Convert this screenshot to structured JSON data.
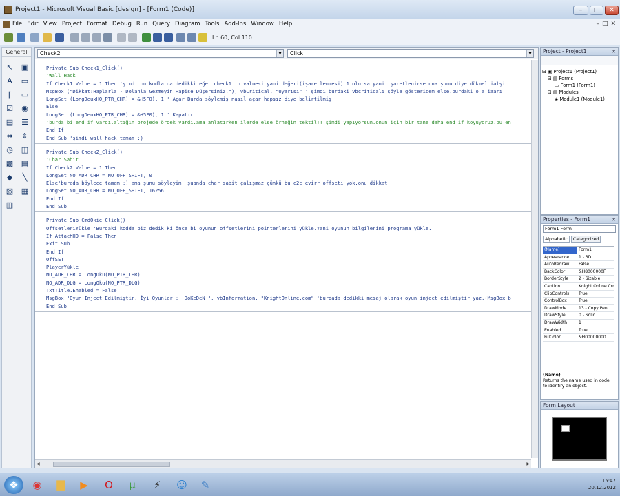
{
  "window": {
    "title": "Project1 - Microsoft Visual Basic [design] - [Form1 (Code)]",
    "controls": [
      "–",
      "□",
      "✕"
    ]
  },
  "menu": {
    "items": [
      "File",
      "Edit",
      "View",
      "Project",
      "Format",
      "Debug",
      "Run",
      "Query",
      "Diagram",
      "Tools",
      "Add-Ins",
      "Window",
      "Help"
    ],
    "mdi_controls": [
      "–",
      "□",
      "✕"
    ]
  },
  "toolbar": {
    "position": "Ln 60, Col 110"
  },
  "toolbox": {
    "header": "General"
  },
  "code_window": {
    "object_combo": "Check2",
    "proc_combo": "Click",
    "procedures": [
      {
        "lines": [
          {
            "t": "Private Sub Check1_Click()",
            "c": "mix"
          },
          {
            "t": "'Wall Hack",
            "c": "cmt"
          },
          {
            "t": "If Check1.Value = 1 Then 'şimdi bu kodlarda dedikki eğer check1 in valuesi yani değeri(işaretlenmesi) 1 olursa yani işaretlenirse ona şunu diye dükmel ialşi",
            "c": "mix"
          },
          {
            "t": "MsgBox (\"Dikkat:Haplarla - Dolanla Gezmeyin Hapise Düşersiniz.\"), vbCritical, \"Uyarısı\" ' şimdi burdaki vbcriticalı şöyle göstericem else.burdaki o a iaarı",
            "c": "mix"
          },
          {
            "t": "LongSet (LongDeuxHO_PTR_CHR) = &H5F0), 1 ' Açar Burda söylemiş nasıl açar hapsız diye belirtilmiş",
            "c": "mix"
          },
          {
            "t": "Else",
            "c": "mix"
          },
          {
            "t": "LongSet (LongDeuxHO_PTR_CHR) = &H5F0), 1 ' Kapatır",
            "c": "mix"
          },
          {
            "t": "'burda bi end if vardı.altığın projede ördek vardı.ama anlatırken ilerde else örneğin tektil!! şimdi yapıyorsun.onun için bir tane daha end if koyuyoruz.bu en",
            "c": "cmt"
          },
          {
            "t": "End If",
            "c": "mix"
          },
          {
            "t": "End Sub 'şimdi wall hack tamam :)",
            "c": "mix"
          }
        ]
      },
      {
        "lines": [
          {
            "t": "Private Sub Check2_Click()",
            "c": "mix"
          },
          {
            "t": "'Char Sabit",
            "c": "cmt"
          },
          {
            "t": "If Check2.Value = 1 Then",
            "c": "mix"
          },
          {
            "t": "LongSet NO_ADR_CHR = NO_OFF_SHIFT, 0",
            "c": "mix"
          },
          {
            "t": "Else'burada böylece tamam :) ama şunu söyleyim  şuanda char sabit çalışmaz çünkü bu c2c evirr offseti yok.onu dikkat",
            "c": "mix"
          },
          {
            "t": "LongSet NO_ADR_CHR = NO_OFF_SHIFT, 16256",
            "c": "mix"
          },
          {
            "t": "End If",
            "c": "mix"
          },
          {
            "t": "End Sub",
            "c": "mix"
          }
        ]
      },
      {
        "lines": [
          {
            "t": "Private Sub CmdOkie_Click()",
            "c": "mix"
          },
          {
            "t": "OffsetleriYükle 'Burdaki kodda biz dedik ki önce bi oyunun offsetlerini pointerlerini yükle.Yani oyunun bilgilerini programa yükle.",
            "c": "mix"
          },
          {
            "t": "If AttachHD = False Then",
            "c": "mix"
          },
          {
            "t": "Exit Sub",
            "c": "mix"
          },
          {
            "t": "End If",
            "c": "mix"
          },
          {
            "t": "OffSET",
            "c": "mix"
          },
          {
            "t": "PlayerYükle",
            "c": "mix"
          },
          {
            "t": "NO_ADR_CHR = LongOku(NO_PTR_CHR)",
            "c": "mix"
          },
          {
            "t": "NO_ADR_DLG = LongOku(NO_PTR_DLG)",
            "c": "mix"
          },
          {
            "t": "TxtTitle.Enabled = False",
            "c": "mix"
          },
          {
            "t": "MsgBox \"Oyun Inject Edilmiştir. İyi Oyunlar :  DoKeDeN \", vbInformation, \"KnightOnline.com\" 'burdada dedikki mesaj olarak oyun inject edilmiştir yaz.(MsgBox b",
            "c": "mix"
          },
          {
            "t": "End Sub",
            "c": "mix"
          }
        ]
      }
    ]
  },
  "project_panel": {
    "title": "Project - Project1",
    "tree": [
      "Project1 (Project1)",
      "Forms",
      "Form1 (Form1)",
      "Modules",
      "Module1 (Module1)"
    ]
  },
  "properties_panel": {
    "title": "Properties - Form1",
    "object": "Form1 Form",
    "tabs": [
      "Alphabetic",
      "Categorized"
    ],
    "rows": [
      {
        "k": "(Name)",
        "v": "Form1"
      },
      {
        "k": "Appearance",
        "v": "1 - 3D"
      },
      {
        "k": "AutoRedraw",
        "v": "False"
      },
      {
        "k": "BackColor",
        "v": "&H8000000F"
      },
      {
        "k": "BorderStyle",
        "v": "2 - Sizable"
      },
      {
        "k": "Caption",
        "v": "Knight Online Crr"
      },
      {
        "k": "ClipControls",
        "v": "True"
      },
      {
        "k": "ControlBox",
        "v": "True"
      },
      {
        "k": "DrawMode",
        "v": "13 - Copy Pen"
      },
      {
        "k": "DrawStyle",
        "v": "0 - Solid"
      },
      {
        "k": "DrawWidth",
        "v": "1"
      },
      {
        "k": "Enabled",
        "v": "True"
      },
      {
        "k": "FillColor",
        "v": "&H00000000"
      }
    ],
    "desc_title": "(Name)",
    "desc_text": "Returns the name used in code to identify an object."
  },
  "layout_panel": {
    "title": "Form Layout"
  },
  "taskbar": {
    "icons": [
      "start-orb",
      "chrome",
      "folder",
      "media-player",
      "opera",
      "utorrent",
      "winamp",
      "messenger",
      "paint"
    ],
    "time": "15:47",
    "date": "20.12.2012"
  }
}
